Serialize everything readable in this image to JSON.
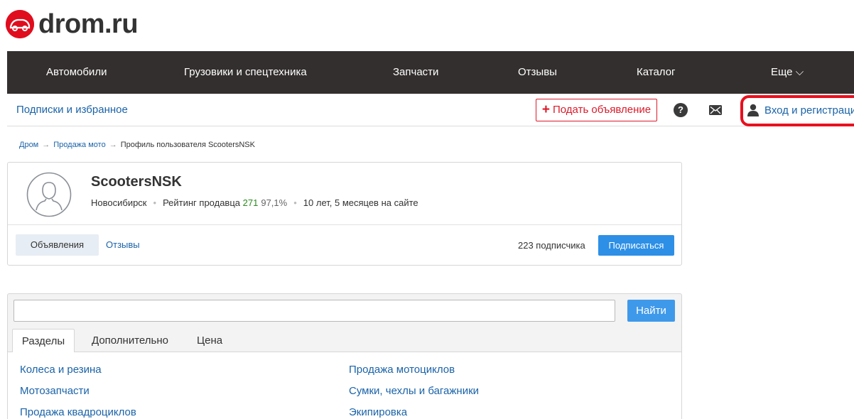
{
  "logo": {
    "text": "drom.ru",
    "icon": "drom-car-logo-icon",
    "brand_color": "#e00d1e"
  },
  "topnav": {
    "items": [
      {
        "label": "Автомобили"
      },
      {
        "label": "Грузовики и спецтехника"
      },
      {
        "label": "Запчасти"
      },
      {
        "label": "Отзывы"
      },
      {
        "label": "Каталог"
      },
      {
        "label": "Еще ⌵"
      }
    ],
    "background": "#332f2e"
  },
  "subnav": {
    "subscriptions_label": "Подписки и избранное",
    "post_ad_label": "Подать объявление",
    "help_icon_glyph": "?",
    "login_label": "Вход и регистрация",
    "login_highlight_color": "#e8101f"
  },
  "breadcrumb": {
    "items": [
      "Дром",
      "Продажа мото",
      "Профиль пользователя ScootersNSK"
    ],
    "separator": "→"
  },
  "profile": {
    "name": "ScootersNSK",
    "city": "Новосибирск",
    "rating_label": "Рейтинг продавца",
    "rating_value": "271",
    "rating_percent": "97,1%",
    "time_on_site": "10 лет, 5 месяцев на сайте",
    "tabs": {
      "ads": "Объявления",
      "reviews": "Отзывы"
    },
    "subscribers": "223 подписчика",
    "subscribe_label": "Подписаться"
  },
  "search": {
    "value": "",
    "placeholder": "",
    "button_label": "Найти",
    "tabs": [
      "Разделы",
      "Дополнительно",
      "Цена"
    ],
    "categories_left": [
      "Колеса и резина",
      "Мотозапчасти",
      "Продажа квадроциклов"
    ],
    "categories_right": [
      "Продажа мотоциклов",
      "Сумки, чехлы и багажники",
      "Экипировка"
    ]
  }
}
